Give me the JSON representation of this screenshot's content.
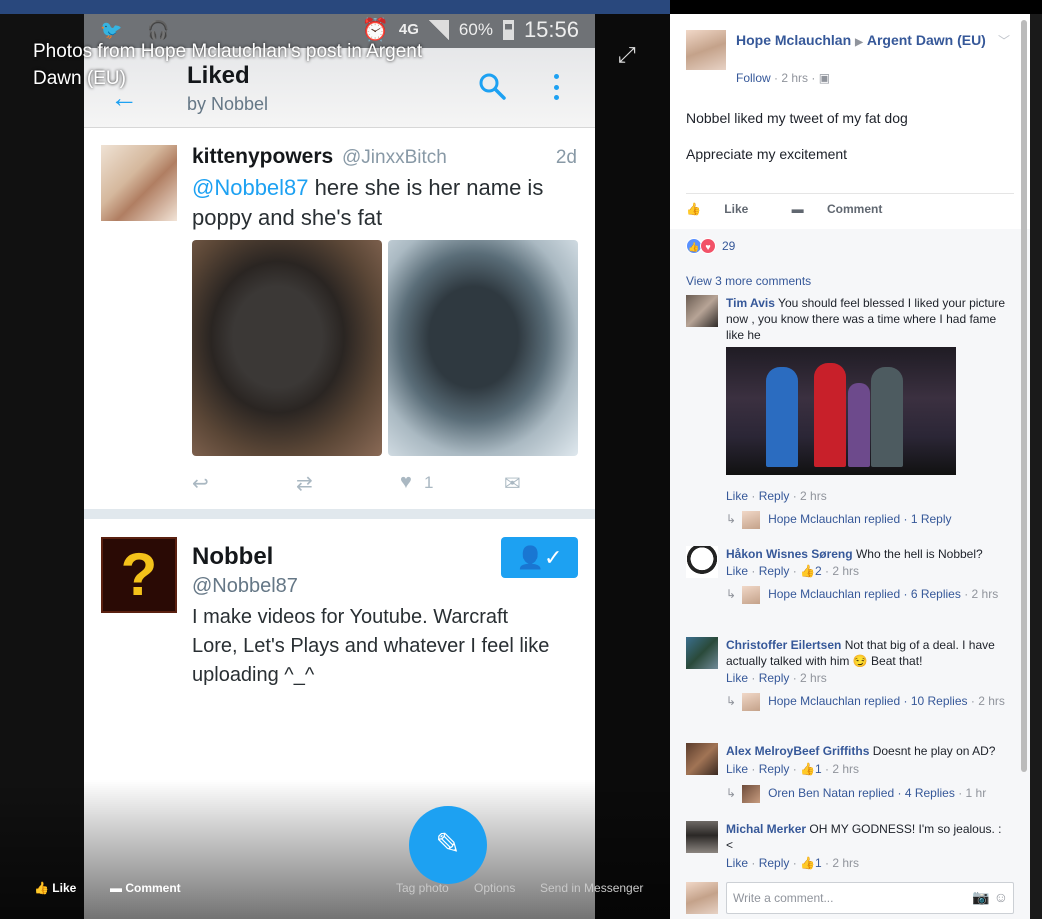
{
  "viewer": {
    "photo_title": "Photos from Hope Mclauchlan's post in Argent Dawn (EU)",
    "bottom": {
      "like": "Like",
      "comment": "Comment",
      "tag_photo": "Tag photo",
      "options": "Options",
      "send_messenger": "Send in Messenger"
    }
  },
  "phone": {
    "status": {
      "network": "4G",
      "battery": "60%",
      "time": "15:56"
    },
    "appbar": {
      "title": "Liked",
      "subtitle": "by Nobbel"
    },
    "tweet": {
      "name": "kittenypowers",
      "handle": "@JinxxBitch",
      "time": "2d",
      "mention": "@Nobbel87",
      "text": " here she is her name is poppy and she's fat",
      "likes": "1"
    },
    "profile": {
      "name": "Nobbel",
      "handle": "@Nobbel87",
      "bio": "I make videos for Youtube. Warcraft Lore, Let's Plays and whatever I feel like uploading ^_^",
      "avatar_glyph": "?"
    }
  },
  "post": {
    "author": "Hope Mclauchlan",
    "group": "Argent Dawn (EU)",
    "follow": "Follow",
    "time": "2 hrs",
    "text1": "Nobbel liked my tweet of my fat dog",
    "text2": "Appreciate my excitement",
    "like": "Like",
    "comment": "Comment",
    "reactions": "29",
    "view_more": "View 3 more comments"
  },
  "comments": [
    {
      "name": "Tim Avis",
      "text": "You should feel blessed I liked your picture now , you know there was a time where I had fame like he",
      "footer_like": "Like",
      "footer_reply": "Reply",
      "footer_time": "2 hrs",
      "reply_label": "Hope Mclauchlan replied",
      "reply_count": "1 Reply",
      "reply_time": ""
    },
    {
      "name": "Håkon Wisnes Søreng",
      "text": "Who the hell is Nobbel?",
      "footer_like": "Like",
      "footer_reply": "Reply",
      "footer_reacts": "2",
      "footer_time": "2 hrs",
      "reply_label": "Hope Mclauchlan replied",
      "reply_count": "6 Replies",
      "reply_time": "2 hrs"
    },
    {
      "name": "Christoffer Eilertsen",
      "text": "Not that big of a deal. I have actually talked with him",
      "text2": "Beat that!",
      "footer_like": "Like",
      "footer_reply": "Reply",
      "footer_time": "2 hrs",
      "reply_label": "Hope Mclauchlan replied",
      "reply_count": "10 Replies",
      "reply_time": "2 hrs"
    },
    {
      "name": "Alex MelroyBeef Griffiths",
      "text": "Doesnt he play on AD?",
      "footer_like": "Like",
      "footer_reply": "Reply",
      "footer_reacts": "1",
      "footer_time": "2 hrs",
      "reply_label": "Oren Ben Natan replied",
      "reply_count": "4 Replies",
      "reply_time": "1 hr"
    },
    {
      "name": "Michal Merker",
      "text": "OH MY GODNESS! I'm so jealous. : <",
      "footer_like": "Like",
      "footer_reply": "Reply",
      "footer_reacts": "1",
      "footer_time": "2 hrs"
    }
  ],
  "composer": {
    "placeholder": "Write a comment..."
  },
  "colors": {
    "twitter_blue": "#1da1f2",
    "fb_link": "#365899",
    "fb_header": "#29487d"
  }
}
